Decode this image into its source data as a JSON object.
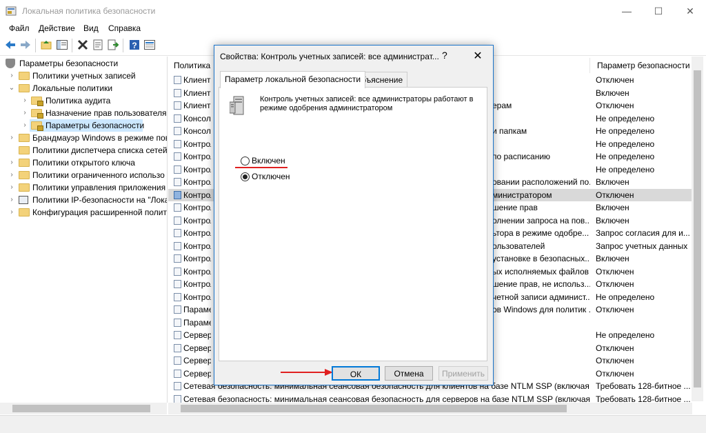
{
  "window": {
    "title": "Локальная политика безопасности",
    "minimize": "—",
    "maximize": "☐",
    "close": "✕"
  },
  "menu": [
    "Файл",
    "Действие",
    "Вид",
    "Справка"
  ],
  "toolbar_icons": [
    "back-icon",
    "forward-icon",
    "up-folder-icon",
    "show-hide-tree-icon",
    "delete-icon",
    "properties-icon",
    "export-icon",
    "help-icon",
    "view-icon"
  ],
  "tree": [
    {
      "label": "Параметры безопасности",
      "level": 0,
      "chevron": "",
      "icon": "shield"
    },
    {
      "label": "Политики учетных записей",
      "level": 1,
      "chevron": "›",
      "icon": "folder"
    },
    {
      "label": "Локальные политики",
      "level": 1,
      "chevron": "⌄",
      "icon": "folder"
    },
    {
      "label": "Политика аудита",
      "level": 2,
      "chevron": "›",
      "icon": "folder-lock"
    },
    {
      "label": "Назначение прав пользователя",
      "level": 2,
      "chevron": "›",
      "icon": "folder-lock"
    },
    {
      "label": "Параметры безопасности",
      "level": 2,
      "chevron": "›",
      "icon": "folder-lock",
      "selected": true
    },
    {
      "label": "Брандмауэр Windows в режиме пов",
      "level": 1,
      "chevron": "›",
      "icon": "folder"
    },
    {
      "label": "Политики диспетчера списка сетей",
      "level": 1,
      "chevron": "",
      "icon": "folder"
    },
    {
      "label": "Политики открытого ключа",
      "level": 1,
      "chevron": "›",
      "icon": "folder"
    },
    {
      "label": "Политики ограниченного использо",
      "level": 1,
      "chevron": "›",
      "icon": "folder"
    },
    {
      "label": "Политики управления приложения",
      "level": 1,
      "chevron": "›",
      "icon": "folder"
    },
    {
      "label": "Политики IP-безопасности на \"Лока",
      "level": 1,
      "chevron": "›",
      "icon": "net"
    },
    {
      "label": "Конфигурация расширенной полит",
      "level": 1,
      "chevron": "›",
      "icon": "folder"
    }
  ],
  "list": {
    "col_policy": "Политика",
    "col_setting": "Параметр безопасности",
    "rows": [
      {
        "name": "Клиент",
        "tail": "",
        "value": "Отключен"
      },
      {
        "name": "Клиент",
        "tail": "",
        "value": "Включен"
      },
      {
        "name": "Клиент",
        "tail": "ерам",
        "value": "Отключен"
      },
      {
        "name": "Консол",
        "tail": "",
        "value": "Не определено"
      },
      {
        "name": "Консол",
        "tail": "и папкам",
        "value": "Не определено"
      },
      {
        "name": "Контрол",
        "tail": "",
        "value": "Не определено"
      },
      {
        "name": "Контрол",
        "tail": "по расписанию",
        "value": "Не определено"
      },
      {
        "name": "Контрол",
        "tail": "",
        "value": "Не определено"
      },
      {
        "name": "Контрол",
        "tail": "овании расположений по...",
        "value": "Включен"
      },
      {
        "name": "Контрол",
        "tail": "министратором",
        "value": "Отключен",
        "selected": true,
        "blue": true
      },
      {
        "name": "Контрол",
        "tail": "шение прав",
        "value": "Включен"
      },
      {
        "name": "Контрол",
        "tail": "олнении запроса на пов...",
        "value": "Включен"
      },
      {
        "name": "Контрол",
        "tail": "ьтора в режиме одобре...",
        "value": "Запрос согласия для и..."
      },
      {
        "name": "Контрол",
        "tail": "ользователей",
        "value": "Запрос учетных данных"
      },
      {
        "name": "Контрол",
        "tail": "установке в безопасных...",
        "value": "Включен"
      },
      {
        "name": "Контрол",
        "tail": "ых исполняемых файлов",
        "value": "Отключен"
      },
      {
        "name": "Контрол",
        "tail": "шение прав, не использ...",
        "value": "Отключен"
      },
      {
        "name": "Контрол",
        "tail": "четной записи админист...",
        "value": "Не определено"
      },
      {
        "name": "Парамет",
        "tail": "ов Windows для политик ...",
        "value": "Отключен"
      },
      {
        "name": "Парамет",
        "tail": "",
        "value": ""
      },
      {
        "name": "Сервер",
        "tail": "",
        "value": "Не определено"
      },
      {
        "name": "Сервер",
        "tail": "",
        "value": "Отключен"
      },
      {
        "name": "Сервер",
        "tail": "",
        "value": "Отключен"
      },
      {
        "name": "Сервер",
        "tail": "",
        "value": "Отключен"
      },
      {
        "name": "Сетевая безопасность: минимальная сеансовая безопасность для клиентов на базе NTLM SSP (включая безо",
        "tail": "",
        "value": "Требовать 128-битное ...",
        "full": true
      },
      {
        "name": "Сетевая безопасность: минимальная сеансовая безопасность для серверов на базе NTLM SSP (включая безо",
        "tail": "",
        "value": "Требовать 128-битное ...",
        "full": true
      }
    ]
  },
  "dialog": {
    "title": "Свойства: Контроль учетных записей: все администрат...",
    "help": "?",
    "close": "✕",
    "tabs": [
      "Параметр локальной безопасности",
      "Объяснение"
    ],
    "policy_text": "Контроль учетных записей: все администраторы работают в режиме одобрения администратором",
    "options": [
      {
        "label": "Включен",
        "checked": false
      },
      {
        "label": "Отключен",
        "checked": true
      }
    ],
    "buttons": {
      "ok": "ОК",
      "cancel": "Отмена",
      "apply": "Применить"
    }
  },
  "colors": {
    "accent": "#0078d7",
    "annotation": "#e02020",
    "selection": "#cce8ff"
  }
}
